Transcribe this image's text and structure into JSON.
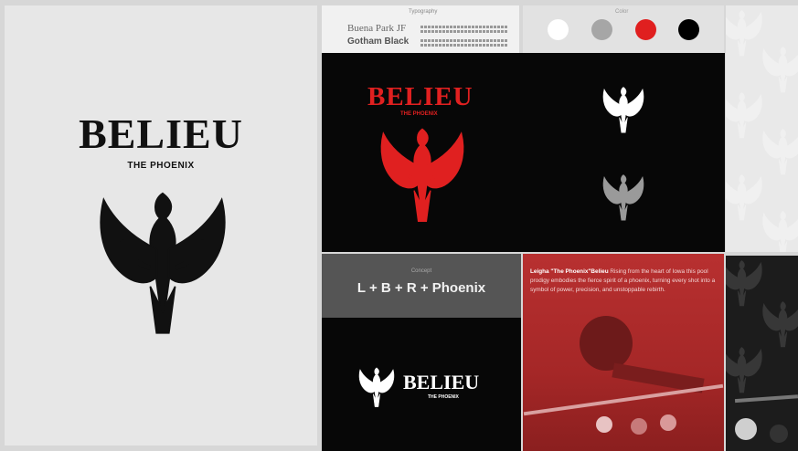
{
  "brand": {
    "wordmark": "BELIEU",
    "subtitle": "THE PHOENIX"
  },
  "typography": {
    "heading": "Typography",
    "fonts": [
      "Buena Park JF",
      "Gotham Black"
    ]
  },
  "colors": {
    "heading": "Color",
    "swatches": [
      "#ffffff",
      "#a6a6a6",
      "#e01f1f",
      "#000000"
    ]
  },
  "concept": {
    "heading": "Concept",
    "formula": "L + B + R + Phoenix"
  },
  "story": {
    "name": "Leigha \"The Phoenix\"Belieu",
    "body": " Rising from the heart of Iowa this pool prodigy embodies the fierce spirit of a phoenix, turning every shot into a symbol of power, precision, and unstoppable rebirth."
  },
  "icons": [
    "phoenix-logo-icon",
    "pattern-phoenix-icon"
  ]
}
